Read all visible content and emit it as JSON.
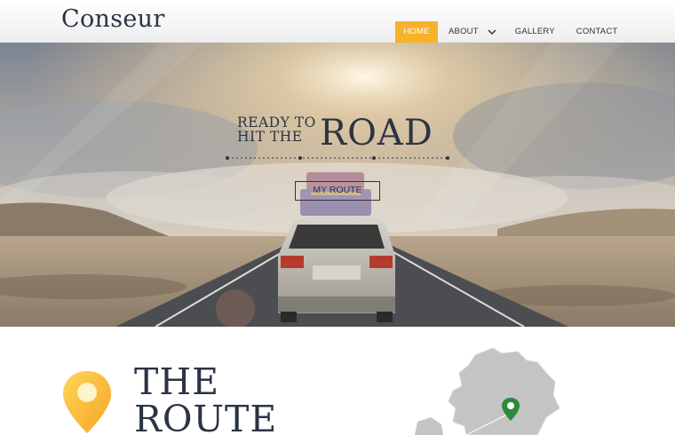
{
  "header": {
    "logo": "Conseur",
    "nav": [
      {
        "label": "HOME",
        "active": true
      },
      {
        "label": "ABOUT",
        "has_dropdown": true
      },
      {
        "label": "GALLERY"
      },
      {
        "label": "CONTACT"
      }
    ]
  },
  "hero": {
    "title_line1": "READY TO",
    "title_line2": "HIT THE",
    "title_big": "ROAD",
    "button": "MY ROUTE"
  },
  "route": {
    "heading_line1": "THE",
    "heading_line2": "ROUTE"
  },
  "colors": {
    "accent": "#f6b22b",
    "heading": "#2b3445",
    "map_gray": "#c4c4c4",
    "map_marker": "#2e8a3a"
  }
}
